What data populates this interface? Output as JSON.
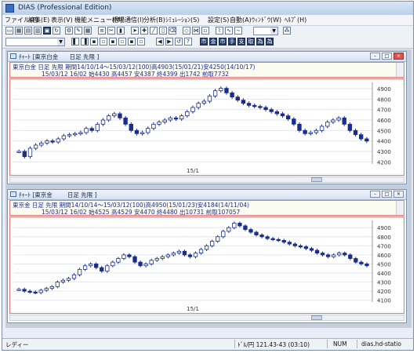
{
  "window": {
    "title": "DIAS (Professional Edition)"
  },
  "menu": [
    "ファイル(F)",
    "編集(E)",
    "表示(V)",
    "機能メニュー(M)",
    "相場通信(I)",
    "分析(B)",
    "ｼﾐｭﾚｰｼｮﾝ(S)",
    "設定(S)",
    "自動(A)",
    "ｳｨﾝﾄﾞｳ(W)",
    "ﾍﾙﾌﾟ(H)"
  ],
  "toolbar2_glyphs": [
    "市",
    "金",
    "市",
    "手",
    "支",
    "取",
    "為",
    "為"
  ],
  "charts": [
    {
      "window_title": "ﾁｬｰﾄ [東京白金",
      "window_title_suffix": "日足 先限 ]",
      "header_line1": "東京白金 日足 先限 期間14/10/14～15/03/12(100)高4903(15/01/21)安4250(14/10/17)",
      "header_line2": "15/03/12 16/02 始4430 高4457 安4387 終4399 出1742 前取7732",
      "x_tick": "15/1",
      "y_ticks": [
        "4900",
        "4800",
        "4700",
        "4600",
        "4500",
        "4400",
        "4300",
        "4200"
      ],
      "chart_data": {
        "type": "line",
        "title": "",
        "xlabel": "",
        "ylabel": "",
        "ylim": [
          4180,
          4960
        ],
        "y_ticks": [
          4900,
          4800,
          4700,
          4600,
          4500,
          4400,
          4300,
          4200
        ],
        "x_ticks": [
          "15/1"
        ],
        "series": [
          {
            "values": [
              4300,
              4250,
              4330,
              4360,
              4380,
              4400,
              4390,
              4420,
              4450,
              4460,
              4470,
              4480,
              4520,
              4500,
              4560,
              4600,
              4640,
              4660,
              4620,
              4560,
              4500,
              4470,
              4480,
              4520,
              4560,
              4580,
              4600,
              4620,
              4610,
              4640,
              4680,
              4720,
              4760,
              4780,
              4830,
              4880,
              4903,
              4860,
              4820,
              4790,
              4760,
              4740,
              4730,
              4720,
              4700,
              4680,
              4660,
              4640,
              4610,
              4560,
              4500,
              4470,
              4480,
              4500,
              4540,
              4580,
              4600,
              4620,
              4560,
              4500,
              4460,
              4420,
              4399
            ]
          }
        ]
      }
    },
    {
      "window_title": "ﾁｬｰﾄ [東京金",
      "window_title_suffix": "日足 先限 ]",
      "header_line1": "東京金 日足 先限 期間14/10/14～15/03/12(100)高4950(15/01/23)安4184(14/11/04)",
      "header_line2": "15/03/12 16/02 始4525 高4529 安4470 終4480 出10731 前取107057",
      "x_tick": "15/1",
      "y_ticks": [
        "4900",
        "4800",
        "4700",
        "4600",
        "4500",
        "4400",
        "4300",
        "4200",
        "4100"
      ],
      "chart_data": {
        "type": "line",
        "title": "",
        "xlabel": "",
        "ylabel": "",
        "ylim": [
          4080,
          4980
        ],
        "y_ticks": [
          4900,
          4800,
          4700,
          4600,
          4500,
          4400,
          4300,
          4200,
          4100
        ],
        "x_ticks": [
          "15/1"
        ],
        "series": [
          {
            "values": [
              4220,
              4200,
              4190,
              4184,
              4210,
              4230,
              4250,
              4300,
              4320,
              4340,
              4380,
              4440,
              4480,
              4500,
              4460,
              4420,
              4480,
              4520,
              4560,
              4600,
              4580,
              4520,
              4480,
              4500,
              4540,
              4560,
              4580,
              4600,
              4620,
              4640,
              4600,
              4580,
              4620,
              4660,
              4700,
              4750,
              4800,
              4860,
              4900,
              4950,
              4920,
              4880,
              4850,
              4820,
              4800,
              4780,
              4770,
              4760,
              4740,
              4720,
              4700,
              4690,
              4670,
              4650,
              4620,
              4600,
              4580,
              4600,
              4620,
              4600,
              4560,
              4520,
              4500,
              4480
            ]
          }
        ]
      }
    }
  ],
  "status": {
    "ready": "レディー",
    "rate": "ﾄﾞﾙ/円 121.43-43 (03:10)",
    "num": "NUM",
    "server": "dias.hd-statio"
  },
  "colors": {
    "up": "#1a2d8c",
    "down": "#1a2d8c",
    "panel_border": "#e07a7a"
  }
}
